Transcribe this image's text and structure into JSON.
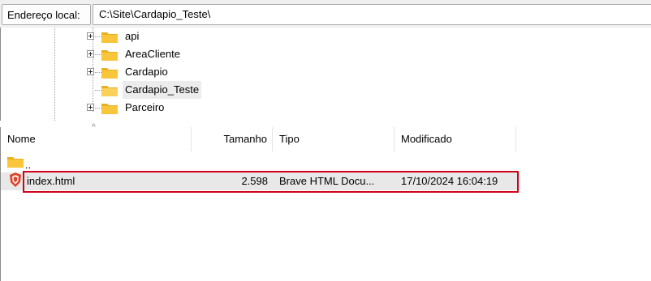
{
  "address_bar": {
    "label": "Endereço local:",
    "path": "C:\\Site\\Cardapio_Teste\\"
  },
  "tree": {
    "items": [
      {
        "label": "api",
        "expandable": true
      },
      {
        "label": "AreaCliente",
        "expandable": true
      },
      {
        "label": "Cardapio",
        "expandable": true
      },
      {
        "label": "Cardapio_Teste",
        "expandable": false,
        "selected": true
      },
      {
        "label": "Parceiro",
        "expandable": true
      }
    ]
  },
  "list": {
    "columns": {
      "name": "Nome",
      "size": "Tamanho",
      "type": "Tipo",
      "modified": "Modificado"
    },
    "parent_entry": "..",
    "files": [
      {
        "name": "index.html",
        "size": "2.598",
        "type": "Brave HTML Docu...",
        "modified": "17/10/2024 16:04:19",
        "icon": "brave-html-icon"
      }
    ]
  },
  "colors": {
    "folder": "#f9c53a",
    "highlight_border": "#d0021b",
    "selection": "#e8e8e8"
  }
}
